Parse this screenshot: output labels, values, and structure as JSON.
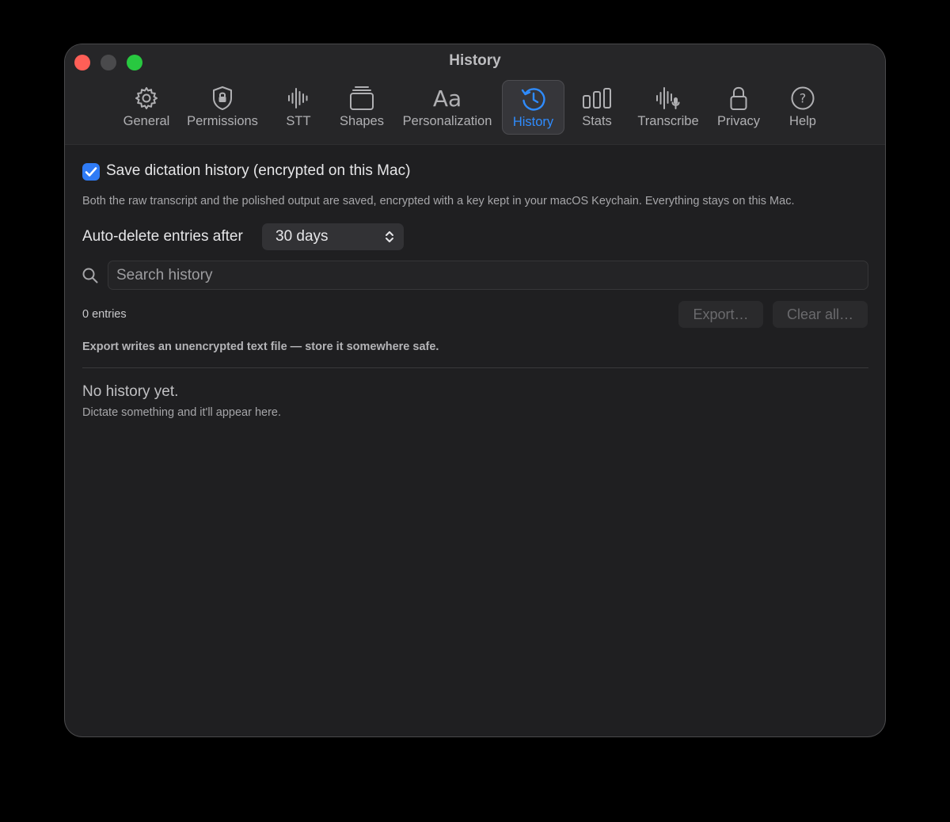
{
  "window": {
    "title": "History"
  },
  "toolbar": {
    "tabs": [
      {
        "label": "General",
        "icon": "gear-icon"
      },
      {
        "label": "Permissions",
        "icon": "shield-lock-icon"
      },
      {
        "label": "STT",
        "icon": "waveform-icon"
      },
      {
        "label": "Shapes",
        "icon": "stack-icon"
      },
      {
        "label": "Personalization",
        "icon": "textformat-icon"
      },
      {
        "label": "History",
        "icon": "clock-history-icon",
        "selected": true
      },
      {
        "label": "Stats",
        "icon": "bar-chart-icon"
      },
      {
        "label": "Transcribe",
        "icon": "waveform-mic-icon"
      },
      {
        "label": "Privacy",
        "icon": "lock-icon"
      },
      {
        "label": "Help",
        "icon": "question-circle-icon"
      }
    ]
  },
  "settings": {
    "save_history_label": "Save dictation history (encrypted on this Mac)",
    "save_history_checked": true,
    "description": "Both the raw transcript and the polished output are saved, encrypted with a key kept in your macOS Keychain. Everything stays on this Mac.",
    "auto_delete_label": "Auto-delete entries after",
    "auto_delete_value": "30 days"
  },
  "search": {
    "placeholder": "Search history",
    "value": ""
  },
  "list": {
    "entries_count": "0 entries",
    "export_label": "Export…",
    "clear_label": "Clear all…",
    "export_warning": "Export writes an unencrypted text file — store it somewhere safe.",
    "empty_title": "No history yet.",
    "empty_subtitle": "Dictate something and it'll appear here."
  },
  "colors": {
    "accent": "#2f8cff",
    "checkbox": "#2f7bf6",
    "window_bg": "#1f1f21",
    "close": "#ff5f57",
    "maximize": "#28c840"
  }
}
